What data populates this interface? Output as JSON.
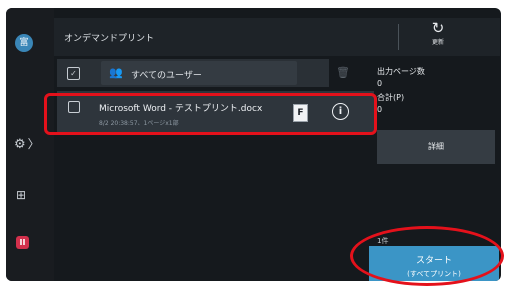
{
  "header": {
    "title": "オンデマンドプリント",
    "refresh_label": "更新"
  },
  "sidebar": {
    "top_icon_text": "富",
    "pause_icon_text": "II"
  },
  "list": {
    "filter_label": "すべてのユーザー",
    "items": [
      {
        "filename": "Microsoft Word - テストプリント.docx",
        "meta": "8/2 20:38:57、1ページx1部",
        "doc_badge": "F"
      }
    ]
  },
  "summary": {
    "output_pages_label": "出力ページ数",
    "output_pages_value": "0",
    "total_label": "合計(P)",
    "total_value": "0"
  },
  "buttons": {
    "detail": "詳細",
    "start_line1": "スタート",
    "start_line2": "(すべてプリント)"
  },
  "job_count": "1件",
  "colors": {
    "accent": "#3b95c6",
    "highlight": "#e4111b",
    "background": "#15191d"
  }
}
